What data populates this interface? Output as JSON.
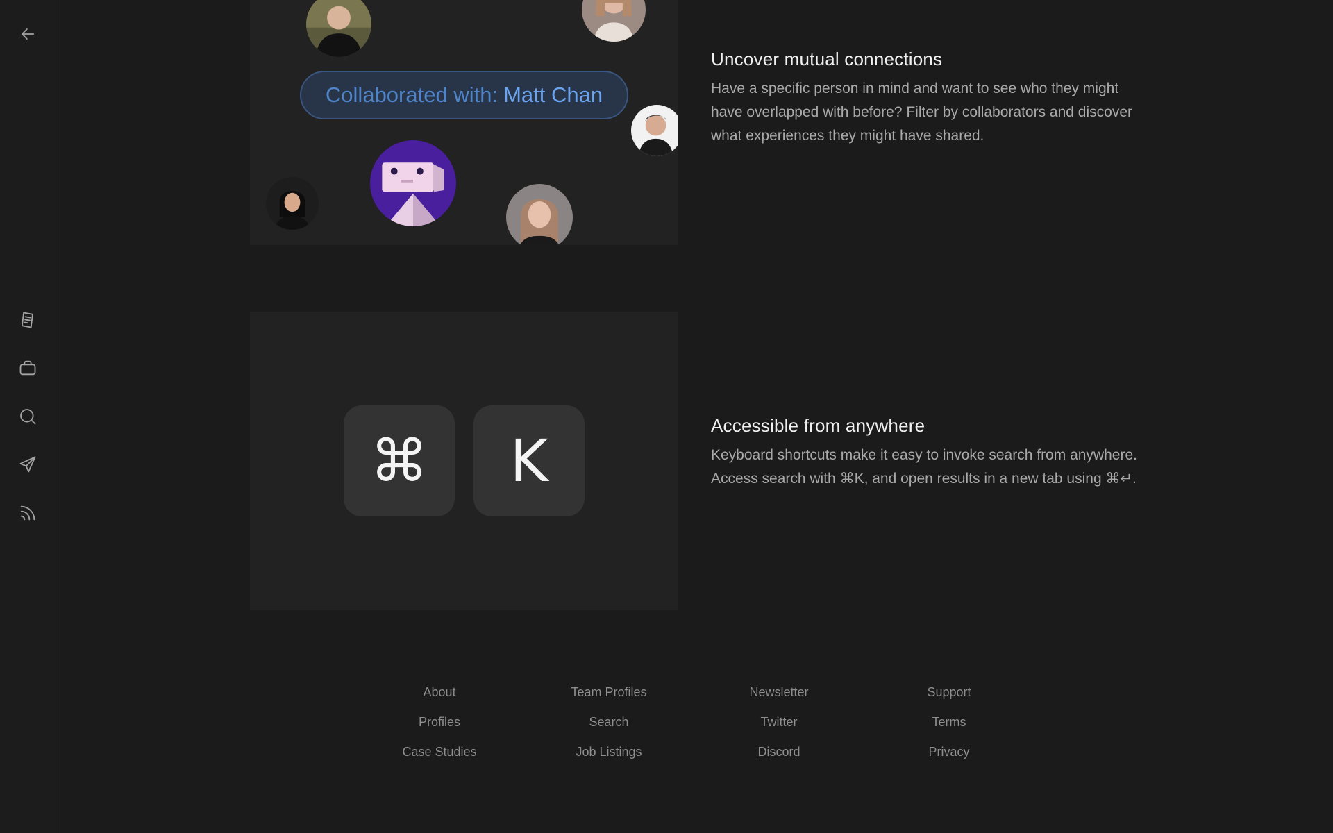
{
  "sidebar": {
    "icons": [
      "back-arrow-icon",
      "document-icon",
      "briefcase-icon",
      "search-icon",
      "send-icon",
      "rss-icon"
    ]
  },
  "collab_pill": {
    "prefix": "Collaborated with:",
    "name": "Matt Chan"
  },
  "keys": {
    "cmd": "⌘",
    "k": "K"
  },
  "features": [
    {
      "title": "Uncover mutual connections",
      "body": "Have a specific person in mind and want to see who they might have overlapped with before? Filter by collaborators and discover what experiences they might have shared."
    },
    {
      "title": "Accessible from anywhere",
      "body": "Keyboard shortcuts make it easy to invoke search from anywhere. Access search with ⌘K, and open results in a new tab using ⌘↵."
    }
  ],
  "footer": {
    "columns": [
      [
        "About",
        "Profiles",
        "Case Studies"
      ],
      [
        "Team Profiles",
        "Search",
        "Job Listings"
      ],
      [
        "Newsletter",
        "Twitter",
        "Discord"
      ],
      [
        "Support",
        "Terms",
        "Privacy"
      ]
    ]
  },
  "colors": {
    "background": "#1b1b1b",
    "panel": "#222222",
    "pill_bg": "#283447",
    "pill_text": "#4f84c9",
    "pill_name": "#6aa3ee"
  }
}
